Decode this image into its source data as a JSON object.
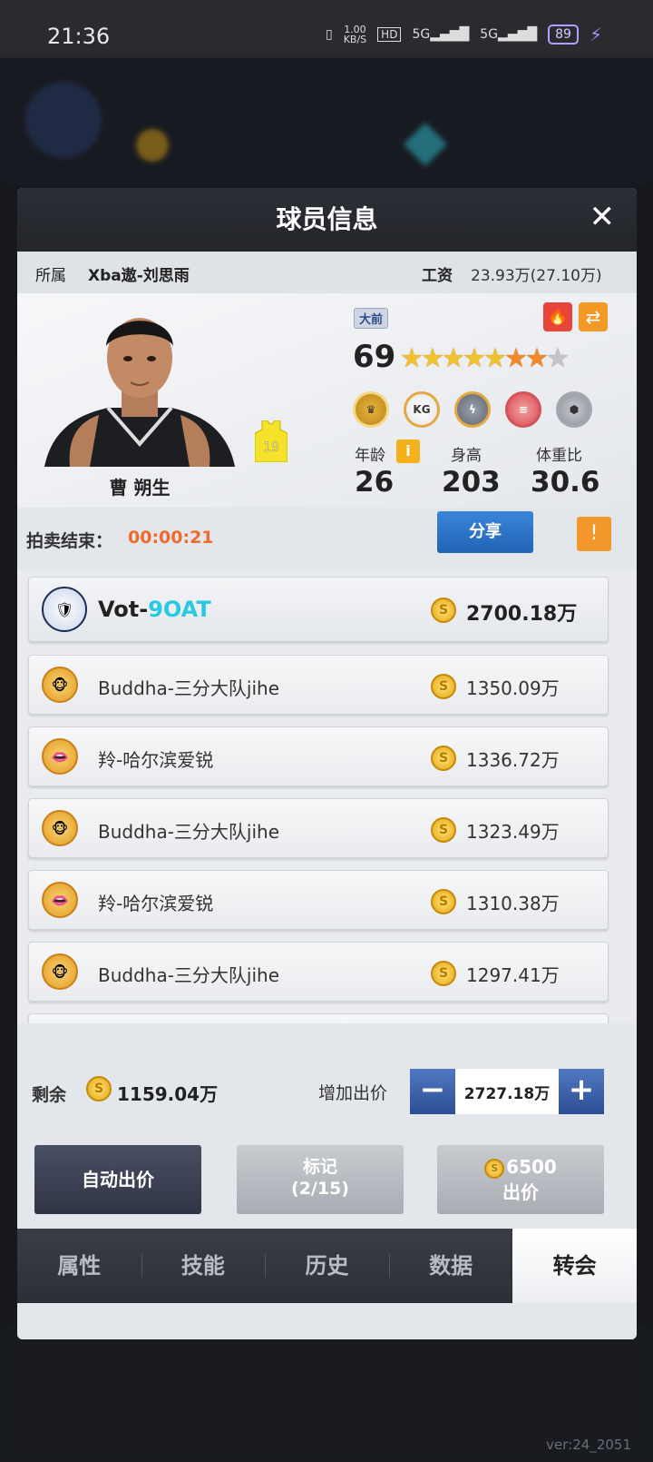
{
  "status_bar": {
    "time": "21:36",
    "net_speed": "1.00",
    "net_unit": "KB/S",
    "hd": "HD",
    "sim1": "5G",
    "sim2": "5G",
    "battery": "89"
  },
  "background": {
    "version": "ver:24_2051"
  },
  "modal": {
    "title": "球员信息",
    "close_label": "✕",
    "team_label": "所属",
    "team_name": "Xba遨-刘思雨",
    "salary_label": "工资",
    "salary_value": "23.93万(27.10万)"
  },
  "player": {
    "name": "曹 朔生",
    "jersey_number": "19",
    "tag": "大前",
    "rating": "69",
    "stars_filled_gold": 5,
    "stars_filled_orange": 2,
    "stars_empty": 1,
    "badges": [
      "gold-badge-icon",
      "kg-badge-icon",
      "lightning-badge-icon",
      "shoe-badge-icon",
      "grey-badge-icon"
    ],
    "badge_b2_text": "KG",
    "age_label": "年龄",
    "age_value": "26",
    "height_label": "身高",
    "height_value": "203",
    "weight_label": "体重比",
    "weight_value": "30.6"
  },
  "auction": {
    "label": "拍卖结束：",
    "time_left": "00:00:21",
    "share_label": "分享",
    "warn_symbol": "!"
  },
  "bids": [
    {
      "name_prefix": "Vot-",
      "name_highlight": "9OAT",
      "amount": "2700.18万"
    },
    {
      "name": "Buddha-三分大队jihe",
      "amount": "1350.09万"
    },
    {
      "name": "羚-哈尔滨爱锐",
      "amount": "1336.72万"
    },
    {
      "name": "Buddha-三分大队jihe",
      "amount": "1323.49万"
    },
    {
      "name": "羚-哈尔滨爱锐",
      "amount": "1310.38万"
    },
    {
      "name": "Buddha-三分大队jihe",
      "amount": "1297.41万"
    }
  ],
  "footer": {
    "remaining_label": "剩余",
    "remaining_value": "1159.04万",
    "increase_label": "增加出价",
    "bid_value": "2727.18万",
    "minus": "−",
    "plus": "+",
    "auto_bid_label": "自动出价",
    "mark_label": "标记",
    "mark_count": "(2/15)",
    "bid_cost": "6500",
    "bid_label": "出价",
    "coin_symbol": "S"
  },
  "tabs": [
    {
      "label": "属性",
      "active": false
    },
    {
      "label": "技能",
      "active": false
    },
    {
      "label": "历史",
      "active": false
    },
    {
      "label": "数据",
      "active": false
    },
    {
      "label": "转会",
      "active": true
    }
  ],
  "colors": {
    "accent_blue": "#2163b5",
    "timer_orange": "#f06a2e",
    "highlight_cyan": "#2bc8e6"
  }
}
